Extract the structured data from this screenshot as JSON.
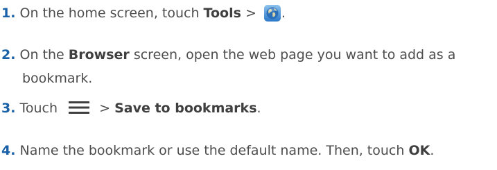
{
  "steps": [
    {
      "number": "1.",
      "text_before": "On the home screen, touch ",
      "bold1": "Tools",
      "separator": " > ",
      "icon": "browser-globe-icon",
      "text_after": "."
    },
    {
      "number": "2.",
      "text_before": "On the ",
      "bold1": "Browser",
      "text_after": " screen, open the web page you want to add as a",
      "continuation": "bookmark."
    },
    {
      "number": "3.",
      "text_before": "Touch ",
      "icon": "menu-icon",
      "separator": " > ",
      "bold1": "Save to bookmarks",
      "text_after": "."
    },
    {
      "number": "4.",
      "text_before": "Name the bookmark or use the default name. Then, touch ",
      "bold1": "OK",
      "text_after": "."
    }
  ],
  "colors": {
    "step_number": "#1a61a8",
    "body_text": "#4d4d4d"
  }
}
